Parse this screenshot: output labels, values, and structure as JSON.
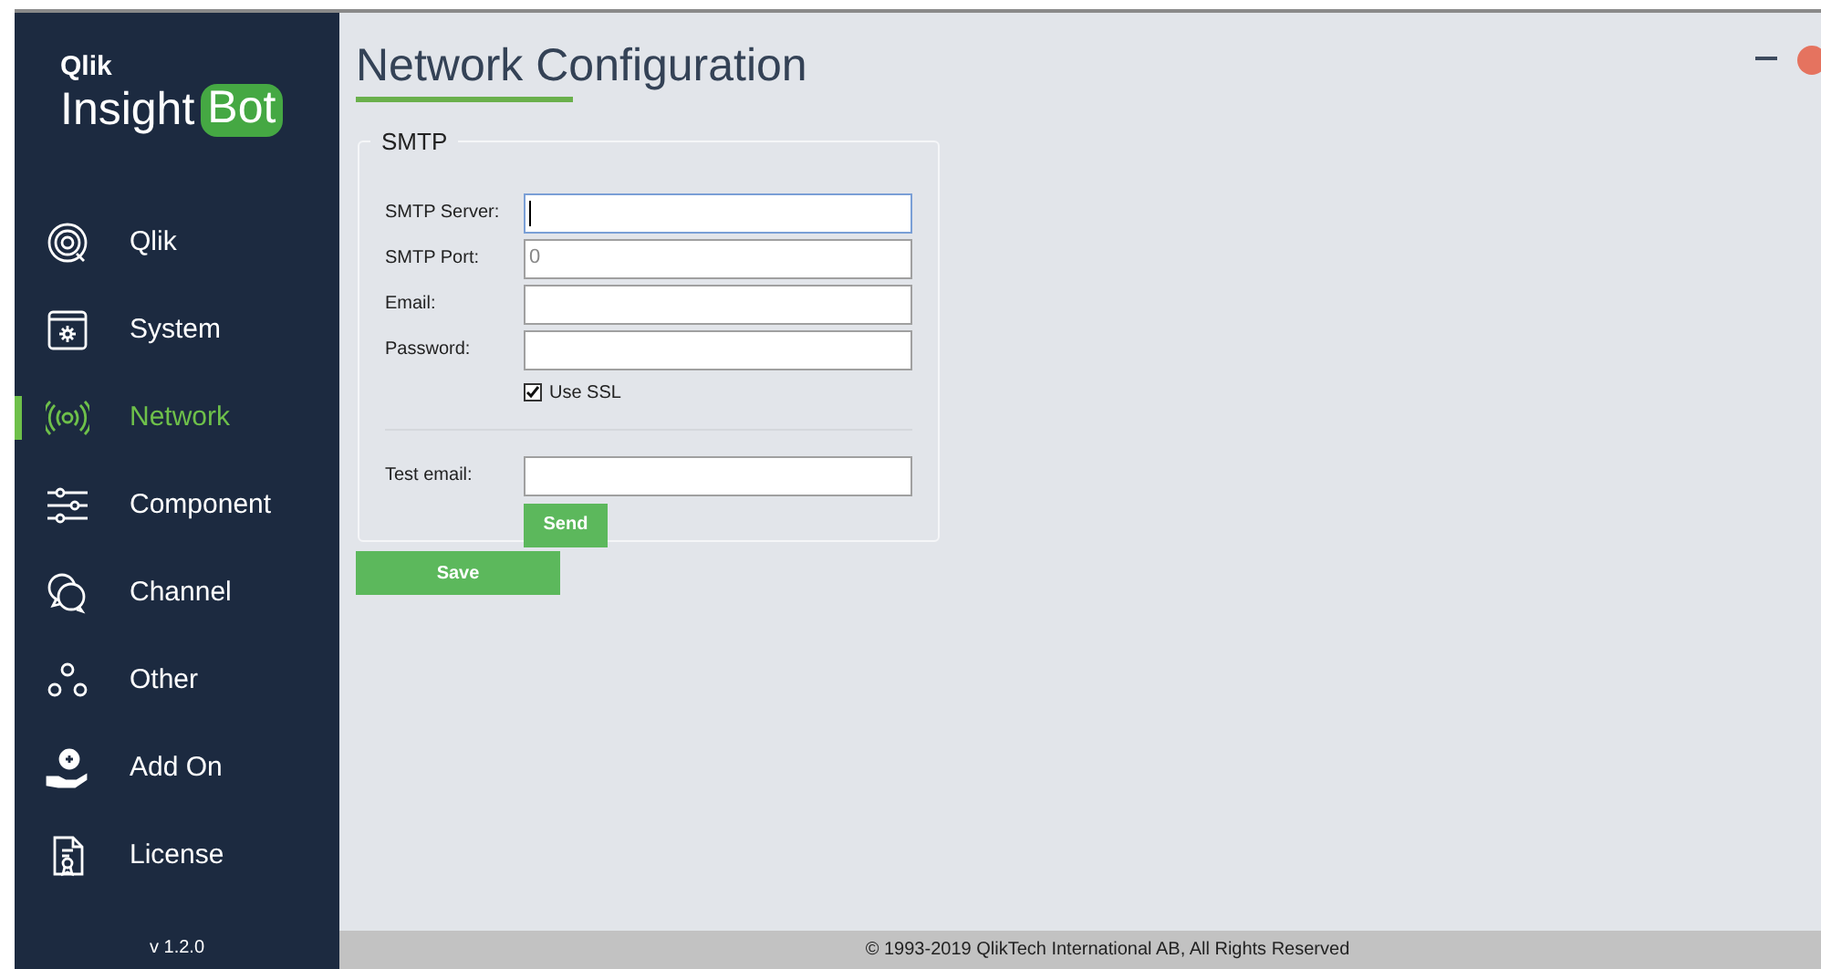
{
  "brand": {
    "top": "Qlik",
    "name": "Insight",
    "badge": "Bot"
  },
  "sidebar": {
    "items": [
      {
        "label": "Qlik",
        "kind": "qlik",
        "selected": false
      },
      {
        "label": "System",
        "kind": "system",
        "selected": false
      },
      {
        "label": "Network",
        "kind": "network",
        "selected": true
      },
      {
        "label": "Component",
        "kind": "component",
        "selected": false
      },
      {
        "label": "Channel",
        "kind": "channel",
        "selected": false
      },
      {
        "label": "Other",
        "kind": "other",
        "selected": false
      },
      {
        "label": "Add On",
        "kind": "addon",
        "selected": false
      },
      {
        "label": "License",
        "kind": "license",
        "selected": false
      }
    ],
    "version": "v 1.2.0"
  },
  "page_title": "Network Configuration",
  "smtp": {
    "legend": "SMTP",
    "fields": [
      {
        "label": "SMTP Server:",
        "focused": true
      },
      {
        "label": "SMTP Port:",
        "value": "0",
        "focused": false
      },
      {
        "label": "Email:",
        "focused": false
      },
      {
        "label": "Password:",
        "focused": false
      }
    ],
    "use_ssl": {
      "label": "Use SSL",
      "checked": true
    },
    "test_email": {
      "label": "Test email:"
    },
    "send_button": "Send"
  },
  "save_button": "Save",
  "footer": "© 1993-2019 QlikTech International AB, All Rights Reserved"
}
